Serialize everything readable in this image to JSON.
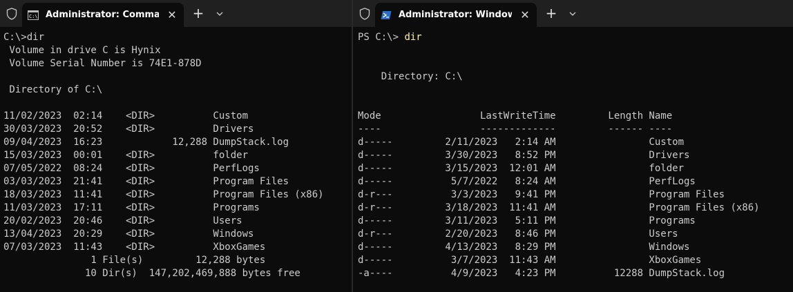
{
  "left": {
    "tab": {
      "title": "Administrator: Command Pro",
      "icon": "cmd-icon"
    },
    "lines": [
      "C:\\>dir",
      " Volume in drive C is Hynix",
      " Volume Serial Number is 74E1-878D",
      "",
      " Directory of C:\\",
      "",
      "11/02/2023  02:14    <DIR>          Custom",
      "30/03/2023  20:52    <DIR>          Drivers",
      "09/04/2023  16:23            12,288 DumpStack.log",
      "15/03/2023  00:01    <DIR>          folder",
      "07/05/2022  08:24    <DIR>          PerfLogs",
      "03/03/2023  21:41    <DIR>          Program Files",
      "18/03/2023  11:41    <DIR>          Program Files (x86)",
      "11/03/2023  17:11    <DIR>          Programs",
      "20/02/2023  20:46    <DIR>          Users",
      "13/04/2023  20:29    <DIR>          Windows",
      "07/03/2023  11:43    <DIR>          XboxGames",
      "               1 File(s)         12,288 bytes",
      "              10 Dir(s)  147,202,469,888 bytes free"
    ]
  },
  "right": {
    "tab": {
      "title": "Administrator: Windows Powe",
      "icon": "powershell-icon"
    },
    "prompt": "PS C:\\> ",
    "command": "dir",
    "lines": [
      "",
      "",
      "    Directory: C:\\",
      "",
      "",
      "Mode                 LastWriteTime         Length Name",
      "----                 -------------         ------ ----",
      "d-----         2/11/2023   2:14 AM                Custom",
      "d-----         3/30/2023   8:52 PM                Drivers",
      "d-----         3/15/2023  12:01 AM                folder",
      "d-----          5/7/2022   8:24 AM                PerfLogs",
      "d-r---          3/3/2023   9:41 PM                Program Files",
      "d-r---         3/18/2023  11:41 AM                Program Files (x86)",
      "d-----         3/11/2023   5:11 PM                Programs",
      "d-r---         2/20/2023   8:46 PM                Users",
      "d-----         4/13/2023   8:29 PM                Windows",
      "d-----          3/7/2023  11:43 AM                XboxGames",
      "-a----          4/9/2023   4:23 PM          12288 DumpStack.log"
    ]
  },
  "titlebar": {
    "new_tab_glyph": "+",
    "close_glyph": "✕"
  },
  "colors": {
    "terminal_bg": "#0c0c0c",
    "terminal_text": "#cccccc",
    "titlebar_bg": "#202020",
    "command_highlight": "#f9f1a5"
  }
}
